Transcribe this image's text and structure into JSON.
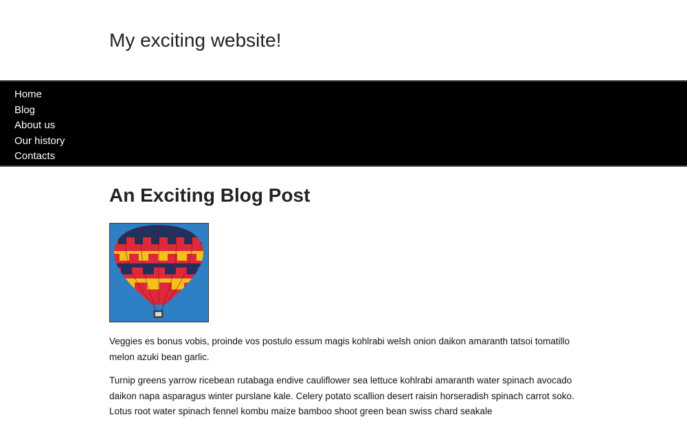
{
  "site": {
    "title": "My exciting website!"
  },
  "nav": {
    "items": [
      {
        "label": "Home"
      },
      {
        "label": "Blog"
      },
      {
        "label": "About us"
      },
      {
        "label": "Our history"
      },
      {
        "label": "Contacts"
      }
    ]
  },
  "post": {
    "title": "An Exciting Blog Post",
    "image_icon": "hot-air-balloon",
    "paragraphs": [
      "Veggies es bonus vobis, proinde vos postulo essum magis kohlrabi welsh onion daikon amaranth tatsoi tomatillo melon azuki bean garlic.",
      "Turnip greens yarrow ricebean rutabaga endive cauliflower sea lettuce kohlrabi amaranth water spinach avocado daikon napa asparagus winter purslane kale. Celery potato scallion desert raisin horseradish spinach carrot soko. Lotus root water spinach fennel kombu maize bamboo shoot green bean swiss chard seakale"
    ]
  },
  "colors": {
    "nav_background": "#000000",
    "sky": "#2e7fc4",
    "balloon_red": "#e0283b",
    "balloon_yellow": "#f2c21b",
    "balloon_navy": "#23305e"
  }
}
